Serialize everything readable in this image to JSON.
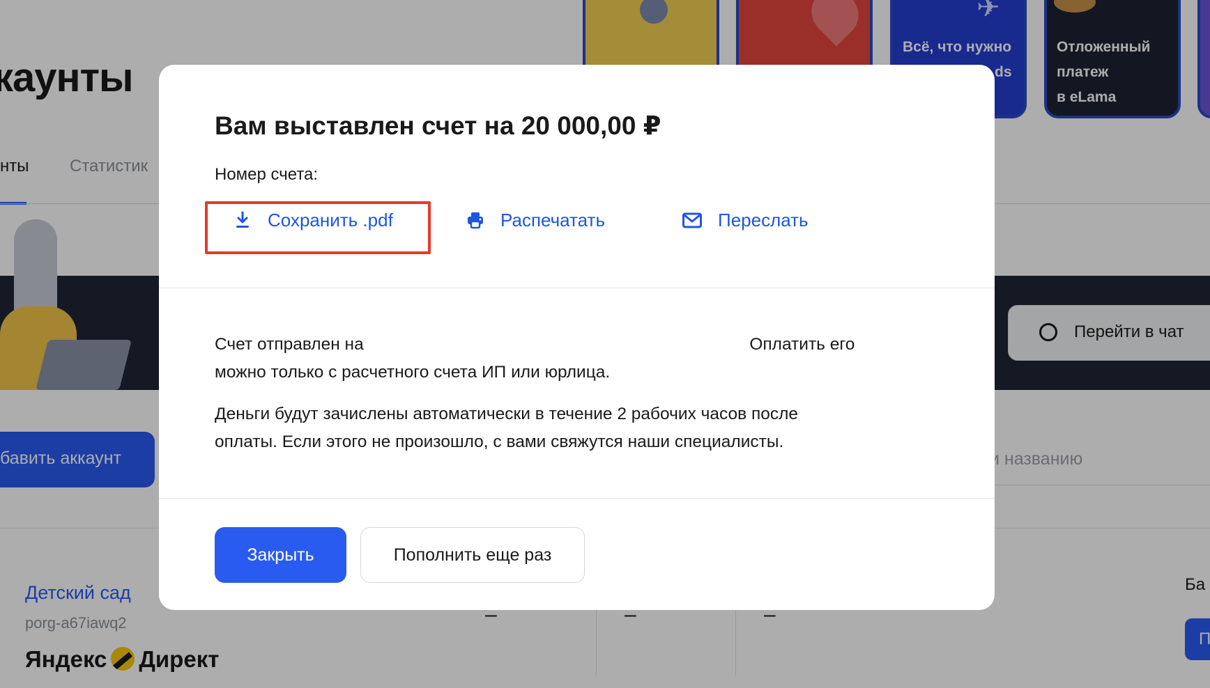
{
  "background": {
    "page_title": "каунты",
    "tabs": {
      "active": "нты",
      "stats": "Статистик"
    },
    "promo_cards": [
      {
        "text": ""
      },
      {
        "text": ""
      },
      {
        "text_lines": [
          "Всё, что нужно",
          "",
          "ds"
        ]
      },
      {
        "text_lines": [
          "Отложенный",
          "платеж",
          "в eLama"
        ]
      }
    ],
    "chat_button": "Перейти в чат",
    "add_account_button": "бавить аккаунт",
    "search_placeholder": "и названию",
    "account": {
      "name": "Детский сад",
      "login": "porg-a67iawq2",
      "logo_left": "Яндекс",
      "logo_right": "Директ",
      "dash": "–",
      "balance_label": "Ба",
      "balance_button": "П"
    }
  },
  "modal": {
    "title": "Вам выставлен счет на 20 000,00 ₽",
    "invoice_number_label": "Номер счета:",
    "actions": {
      "save": "Сохранить .pdf",
      "print": "Распечатать",
      "send": "Переслать"
    },
    "sent_line1_a": "Счет отправлен на",
    "sent_line1_b": "Оплатить его",
    "sent_line2": "можно только с расчетного счета ИП или юрлица.",
    "money_line1": "Деньги будут зачислены автоматически в течение 2 рабочих часов после",
    "money_line2": "оплаты. Если этого не произошло, с вами свяжутся наши специалисты.",
    "close_button": "Закрыть",
    "top_up_again_button": "Пополнить еще раз"
  }
}
